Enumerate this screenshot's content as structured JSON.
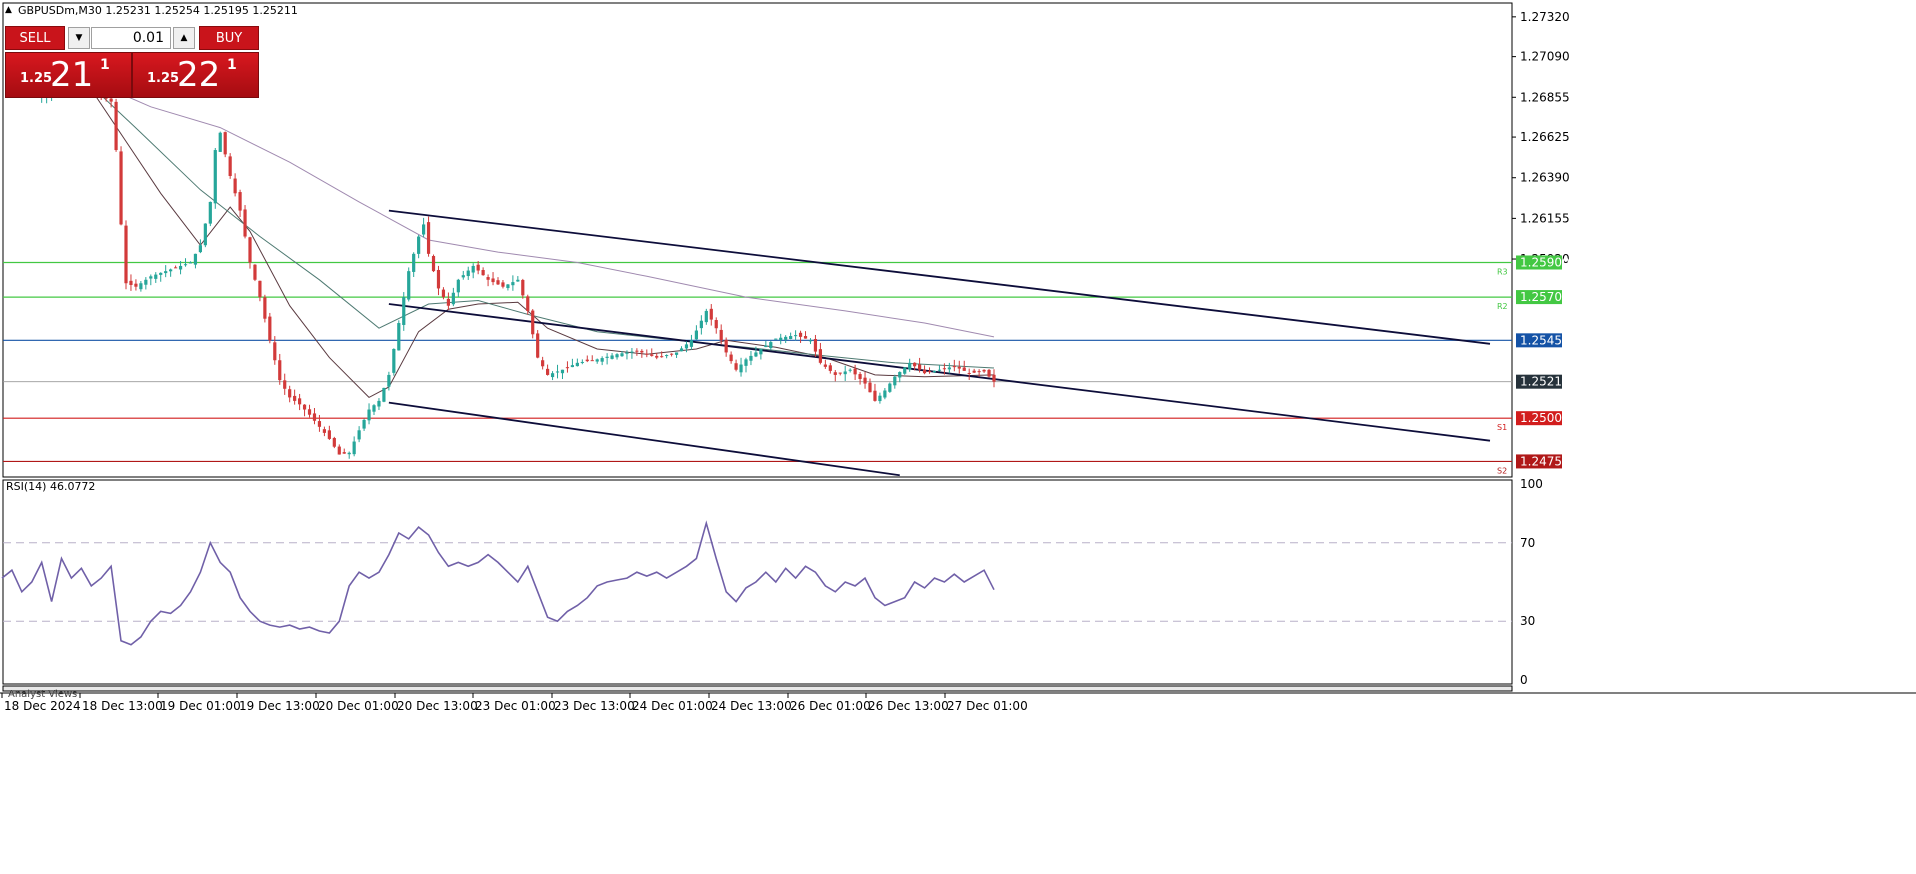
{
  "header": {
    "symbol_line": "GBPUSDm,M30  1.25231 1.25254 1.25195 1.25211"
  },
  "trade_panel": {
    "sell_label": "SELL",
    "buy_label": "BUY",
    "lot_value": "0.01",
    "sell_price": {
      "small": "1.25",
      "big": "21",
      "sup": "1"
    },
    "buy_price": {
      "small": "1.25",
      "big": "22",
      "sup": "1"
    },
    "colors": {
      "button": "#c9141b"
    }
  },
  "price_axis": {
    "ticks": [
      "1.27320",
      "1.27090",
      "1.26855",
      "1.26625",
      "1.26390",
      "1.26155",
      "1.25920"
    ]
  },
  "levels": [
    {
      "value": 1.259,
      "label": "1.25900",
      "tag": "R3",
      "color": "#43c843",
      "text_color": "#1f6b1f"
    },
    {
      "value": 1.257,
      "label": "1.25700",
      "tag": "R2",
      "color": "#43c843",
      "text_color": "#1f6b1f"
    },
    {
      "value": 1.2545,
      "label": "1.25450",
      "tag": "",
      "color": "#1452a6",
      "text_color": "#ffffff"
    },
    {
      "value": 1.25211,
      "label": "1.25211",
      "tag": "",
      "color": "#9a9a9a",
      "text_color": "#ffffff",
      "box": "#26323b"
    },
    {
      "value": 1.25,
      "label": "1.25000",
      "tag": "S1",
      "color": "#d21d1d",
      "text_color": "#ffffff"
    },
    {
      "value": 1.2475,
      "label": "1.24750",
      "tag": "S2",
      "color": "#b01818",
      "text_color": "#ffffff"
    }
  ],
  "time_axis": {
    "labels": [
      "18 Dec 2024",
      "18 Dec 13:00",
      "19 Dec 01:00",
      "19 Dec 13:00",
      "20 Dec 01:00",
      "20 Dec 13:00",
      "23 Dec 01:00",
      "23 Dec 13:00",
      "24 Dec 01:00",
      "24 Dec 13:00",
      "26 Dec 01:00",
      "26 Dec 13:00",
      "27 Dec 01:00"
    ]
  },
  "rsi": {
    "label": "RSI(14) 46.0772",
    "ticks": [
      "100",
      "70",
      "30",
      "0"
    ],
    "color": "#7060a8"
  },
  "analyst_tab": "Analyst Views",
  "chart_data": {
    "type": "candlestick",
    "symbol": "GBPUSDm",
    "timeframe": "M30",
    "ohlc_last": {
      "open": 1.25231,
      "high": 1.25254,
      "low": 1.25195,
      "close": 1.25211
    },
    "ylim": [
      1.2466,
      1.274
    ],
    "close_path": [
      [
        0,
        1.269
      ],
      [
        6,
        1.2688
      ],
      [
        10,
        1.2686
      ],
      [
        14,
        1.2692
      ],
      [
        18,
        1.269
      ],
      [
        22,
        1.2683
      ],
      [
        23,
        1.2655
      ],
      [
        24,
        1.2612
      ],
      [
        25,
        1.2578
      ],
      [
        27,
        1.2576
      ],
      [
        30,
        1.2582
      ],
      [
        33,
        1.2585
      ],
      [
        36,
        1.2588
      ],
      [
        38,
        1.259
      ],
      [
        40,
        1.26
      ],
      [
        42,
        1.2625
      ],
      [
        43,
        1.2655
      ],
      [
        44,
        1.2665
      ],
      [
        46,
        1.264
      ],
      [
        48,
        1.262
      ],
      [
        50,
        1.259
      ],
      [
        52,
        1.257
      ],
      [
        54,
        1.2545
      ],
      [
        56,
        1.2522
      ],
      [
        58,
        1.2512
      ],
      [
        60,
        1.2508
      ],
      [
        62,
        1.2502
      ],
      [
        64,
        1.2495
      ],
      [
        66,
        1.2488
      ],
      [
        68,
        1.2479
      ],
      [
        70,
        1.248
      ],
      [
        72,
        1.2493
      ],
      [
        74,
        1.2505
      ],
      [
        76,
        1.251
      ],
      [
        78,
        1.2525
      ],
      [
        80,
        1.2555
      ],
      [
        82,
        1.2585
      ],
      [
        84,
        1.2605
      ],
      [
        85,
        1.2612
      ],
      [
        86,
        1.2595
      ],
      [
        88,
        1.2575
      ],
      [
        90,
        1.2565
      ],
      [
        92,
        1.258
      ],
      [
        95,
        1.2588
      ],
      [
        98,
        1.258
      ],
      [
        101,
        1.2576
      ],
      [
        104,
        1.258
      ],
      [
        106,
        1.2562
      ],
      [
        108,
        1.2535
      ],
      [
        110,
        1.2525
      ],
      [
        113,
        1.2528
      ],
      [
        116,
        1.2532
      ],
      [
        120,
        1.2534
      ],
      [
        124,
        1.2537
      ],
      [
        128,
        1.2539
      ],
      [
        132,
        1.2535
      ],
      [
        136,
        1.2538
      ],
      [
        139,
        1.2545
      ],
      [
        142,
        1.2562
      ],
      [
        144,
        1.2552
      ],
      [
        146,
        1.2538
      ],
      [
        148,
        1.2528
      ],
      [
        150,
        1.2534
      ],
      [
        153,
        1.254
      ],
      [
        156,
        1.2546
      ],
      [
        160,
        1.2548
      ],
      [
        163,
        1.2545
      ],
      [
        165,
        1.2532
      ],
      [
        168,
        1.2525
      ],
      [
        171,
        1.2528
      ],
      [
        174,
        1.252
      ],
      [
        176,
        1.251
      ],
      [
        178,
        1.2516
      ],
      [
        180,
        1.2524
      ],
      [
        183,
        1.2532
      ],
      [
        186,
        1.2526
      ],
      [
        189,
        1.2528
      ],
      [
        192,
        1.253
      ],
      [
        195,
        1.2526
      ],
      [
        198,
        1.2527
      ],
      [
        200,
        1.25211
      ]
    ],
    "ma_fast": [
      [
        18,
        1.269
      ],
      [
        25,
        1.266
      ],
      [
        32,
        1.263
      ],
      [
        40,
        1.26
      ],
      [
        46,
        1.2622
      ],
      [
        50,
        1.2608
      ],
      [
        58,
        1.2565
      ],
      [
        66,
        1.2535
      ],
      [
        74,
        1.2512
      ],
      [
        78,
        1.2518
      ],
      [
        84,
        1.255
      ],
      [
        90,
        1.2563
      ],
      [
        96,
        1.2566
      ],
      [
        104,
        1.2567
      ],
      [
        110,
        1.2552
      ],
      [
        120,
        1.254
      ],
      [
        130,
        1.2537
      ],
      [
        140,
        1.254
      ],
      [
        146,
        1.2545
      ],
      [
        156,
        1.2541
      ],
      [
        166,
        1.2535
      ],
      [
        176,
        1.2525
      ],
      [
        186,
        1.2524
      ],
      [
        200,
        1.2525
      ]
    ],
    "ma_mid": [
      [
        18,
        1.2692
      ],
      [
        28,
        1.2665
      ],
      [
        40,
        1.2632
      ],
      [
        52,
        1.2605
      ],
      [
        64,
        1.258
      ],
      [
        76,
        1.2552
      ],
      [
        86,
        1.2566
      ],
      [
        96,
        1.2568
      ],
      [
        106,
        1.256
      ],
      [
        120,
        1.255
      ],
      [
        136,
        1.2545
      ],
      [
        150,
        1.2541
      ],
      [
        166,
        1.2536
      ],
      [
        180,
        1.2532
      ],
      [
        200,
        1.2529
      ]
    ],
    "ma_slow": [
      [
        18,
        1.2695
      ],
      [
        30,
        1.268
      ],
      [
        44,
        1.2668
      ],
      [
        58,
        1.2648
      ],
      [
        72,
        1.2625
      ],
      [
        86,
        1.2603
      ],
      [
        100,
        1.2596
      ],
      [
        116,
        1.259
      ],
      [
        130,
        1.2582
      ],
      [
        150,
        1.257
      ],
      [
        170,
        1.2562
      ],
      [
        186,
        1.2555
      ],
      [
        200,
        1.2547
      ]
    ],
    "channel": {
      "upper": [
        [
          78,
          1.262
        ],
        [
          300,
          1.2543
        ]
      ],
      "middle": [
        [
          78,
          1.2566
        ],
        [
          300,
          1.2487
        ]
      ],
      "lower": [
        [
          78,
          1.2509
        ],
        [
          181,
          1.2467
        ]
      ]
    },
    "rsi_series": [
      [
        0,
        52
      ],
      [
        2,
        56
      ],
      [
        4,
        45
      ],
      [
        6,
        50
      ],
      [
        8,
        60
      ],
      [
        10,
        40
      ],
      [
        12,
        62
      ],
      [
        14,
        52
      ],
      [
        16,
        57
      ],
      [
        18,
        48
      ],
      [
        20,
        52
      ],
      [
        22,
        58
      ],
      [
        24,
        20
      ],
      [
        26,
        18
      ],
      [
        28,
        22
      ],
      [
        30,
        30
      ],
      [
        32,
        35
      ],
      [
        34,
        34
      ],
      [
        36,
        38
      ],
      [
        38,
        45
      ],
      [
        40,
        55
      ],
      [
        42,
        70
      ],
      [
        44,
        60
      ],
      [
        46,
        55
      ],
      [
        48,
        42
      ],
      [
        50,
        35
      ],
      [
        52,
        30
      ],
      [
        54,
        28
      ],
      [
        56,
        27
      ],
      [
        58,
        28
      ],
      [
        60,
        26
      ],
      [
        62,
        27
      ],
      [
        64,
        25
      ],
      [
        66,
        24
      ],
      [
        68,
        30
      ],
      [
        70,
        48
      ],
      [
        72,
        55
      ],
      [
        74,
        52
      ],
      [
        76,
        55
      ],
      [
        78,
        64
      ],
      [
        80,
        75
      ],
      [
        82,
        72
      ],
      [
        84,
        78
      ],
      [
        86,
        74
      ],
      [
        88,
        65
      ],
      [
        90,
        58
      ],
      [
        92,
        60
      ],
      [
        94,
        58
      ],
      [
        96,
        60
      ],
      [
        98,
        64
      ],
      [
        100,
        60
      ],
      [
        102,
        55
      ],
      [
        104,
        50
      ],
      [
        106,
        58
      ],
      [
        108,
        45
      ],
      [
        110,
        32
      ],
      [
        112,
        30
      ],
      [
        114,
        35
      ],
      [
        116,
        38
      ],
      [
        118,
        42
      ],
      [
        120,
        48
      ],
      [
        122,
        50
      ],
      [
        124,
        51
      ],
      [
        126,
        52
      ],
      [
        128,
        55
      ],
      [
        130,
        53
      ],
      [
        132,
        55
      ],
      [
        134,
        52
      ],
      [
        136,
        55
      ],
      [
        138,
        58
      ],
      [
        140,
        62
      ],
      [
        142,
        80
      ],
      [
        144,
        62
      ],
      [
        146,
        45
      ],
      [
        148,
        40
      ],
      [
        150,
        47
      ],
      [
        152,
        50
      ],
      [
        154,
        55
      ],
      [
        156,
        50
      ],
      [
        158,
        57
      ],
      [
        160,
        52
      ],
      [
        162,
        58
      ],
      [
        164,
        55
      ],
      [
        166,
        48
      ],
      [
        168,
        45
      ],
      [
        170,
        50
      ],
      [
        172,
        48
      ],
      [
        174,
        52
      ],
      [
        176,
        42
      ],
      [
        178,
        38
      ],
      [
        180,
        40
      ],
      [
        182,
        42
      ],
      [
        184,
        50
      ],
      [
        186,
        47
      ],
      [
        188,
        52
      ],
      [
        190,
        50
      ],
      [
        192,
        54
      ],
      [
        194,
        50
      ],
      [
        196,
        53
      ],
      [
        198,
        56
      ],
      [
        200,
        46.0772
      ]
    ],
    "rsi_levels": [
      70,
      30
    ]
  }
}
